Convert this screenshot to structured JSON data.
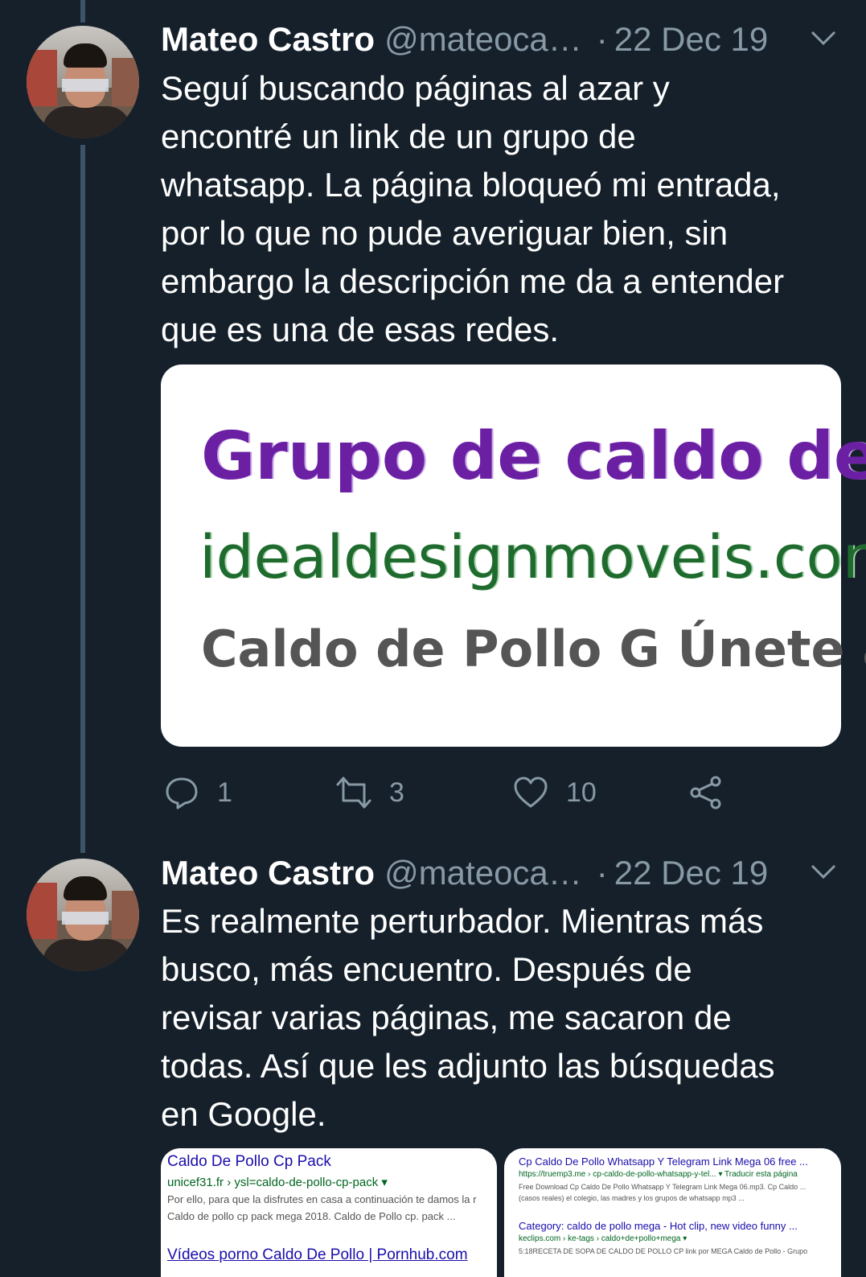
{
  "tweets": [
    {
      "author_name": "Mateo Castro",
      "author_handle": "@mateoca…",
      "separator": "·",
      "date": "22 Dec 19",
      "text": "Seguí buscando páginas al azar y\nencontré un link de un grupo de\nwhatsapp. La página bloqueó mi entrada,\npor lo que no pude averiguar bien, sin\nembargo la descripción me da a entender\nque es una de esas redes.",
      "media": {
        "line1": "Grupo de caldo de",
        "line2": "idealdesignmoveis.com",
        "line3": "Caldo de Pollo G Únete a"
      },
      "actions": {
        "replies": "1",
        "retweets": "3",
        "likes": "10"
      }
    },
    {
      "author_name": "Mateo Castro",
      "author_handle": "@mateoca…",
      "separator": "·",
      "date": "22 Dec 19",
      "text": "Es realmente perturbador. Mientras más\nbusco, más encuentro. Después de\nrevisar varias páginas, me sacaron de\ntodas. Así que les adjunto las búsquedas\nen Google.",
      "thumbnails": {
        "left": {
          "title": "Caldo De Pollo Cp Pack",
          "url": "unicef31.fr › ysl=caldo-de-pollo-cp-pack ▾",
          "snippet1": "Por ello, para que la disfrutes en casa a continuación te damos la r",
          "snippet2": "Caldo de pollo cp pack mega 2018. Caldo de Pollo cp. pack ...",
          "title2": "Vídeos porno Caldo De Pollo | Pornhub.com"
        },
        "right": {
          "title": "Cp Caldo De Pollo Whatsapp Y Telegram Link Mega 06 free ...",
          "url": "https://truemp3.me › cp-caldo-de-pollo-whatsapp-y-tel... ▾ Traducir esta página",
          "snippet1": "Free Download Cp Caldo De Pollo Whatsapp Y Telegram Link Mega 06.mp3. Cp Caldo ...",
          "snippet2": "(casos reales) el colegio, las madres y los grupos de whatsapp mp3 ...",
          "title2": "Category: caldo de pollo mega - Hot clip, new video funny ...",
          "url2": "keclips.com › ke-tags › caldo+de+pollo+mega ▾",
          "snippet3": "5:18RECETA DE SOPA DE CALDO DE POLLO CP link por MEGA Caldo de Pollo - Grupo"
        }
      }
    }
  ],
  "colors": {
    "background": "#15202b",
    "secondary_text": "#8899a6",
    "thread_line": "#3d5466"
  },
  "icons": [
    "chevron-down-icon",
    "reply-icon",
    "retweet-icon",
    "like-icon",
    "share-icon"
  ]
}
